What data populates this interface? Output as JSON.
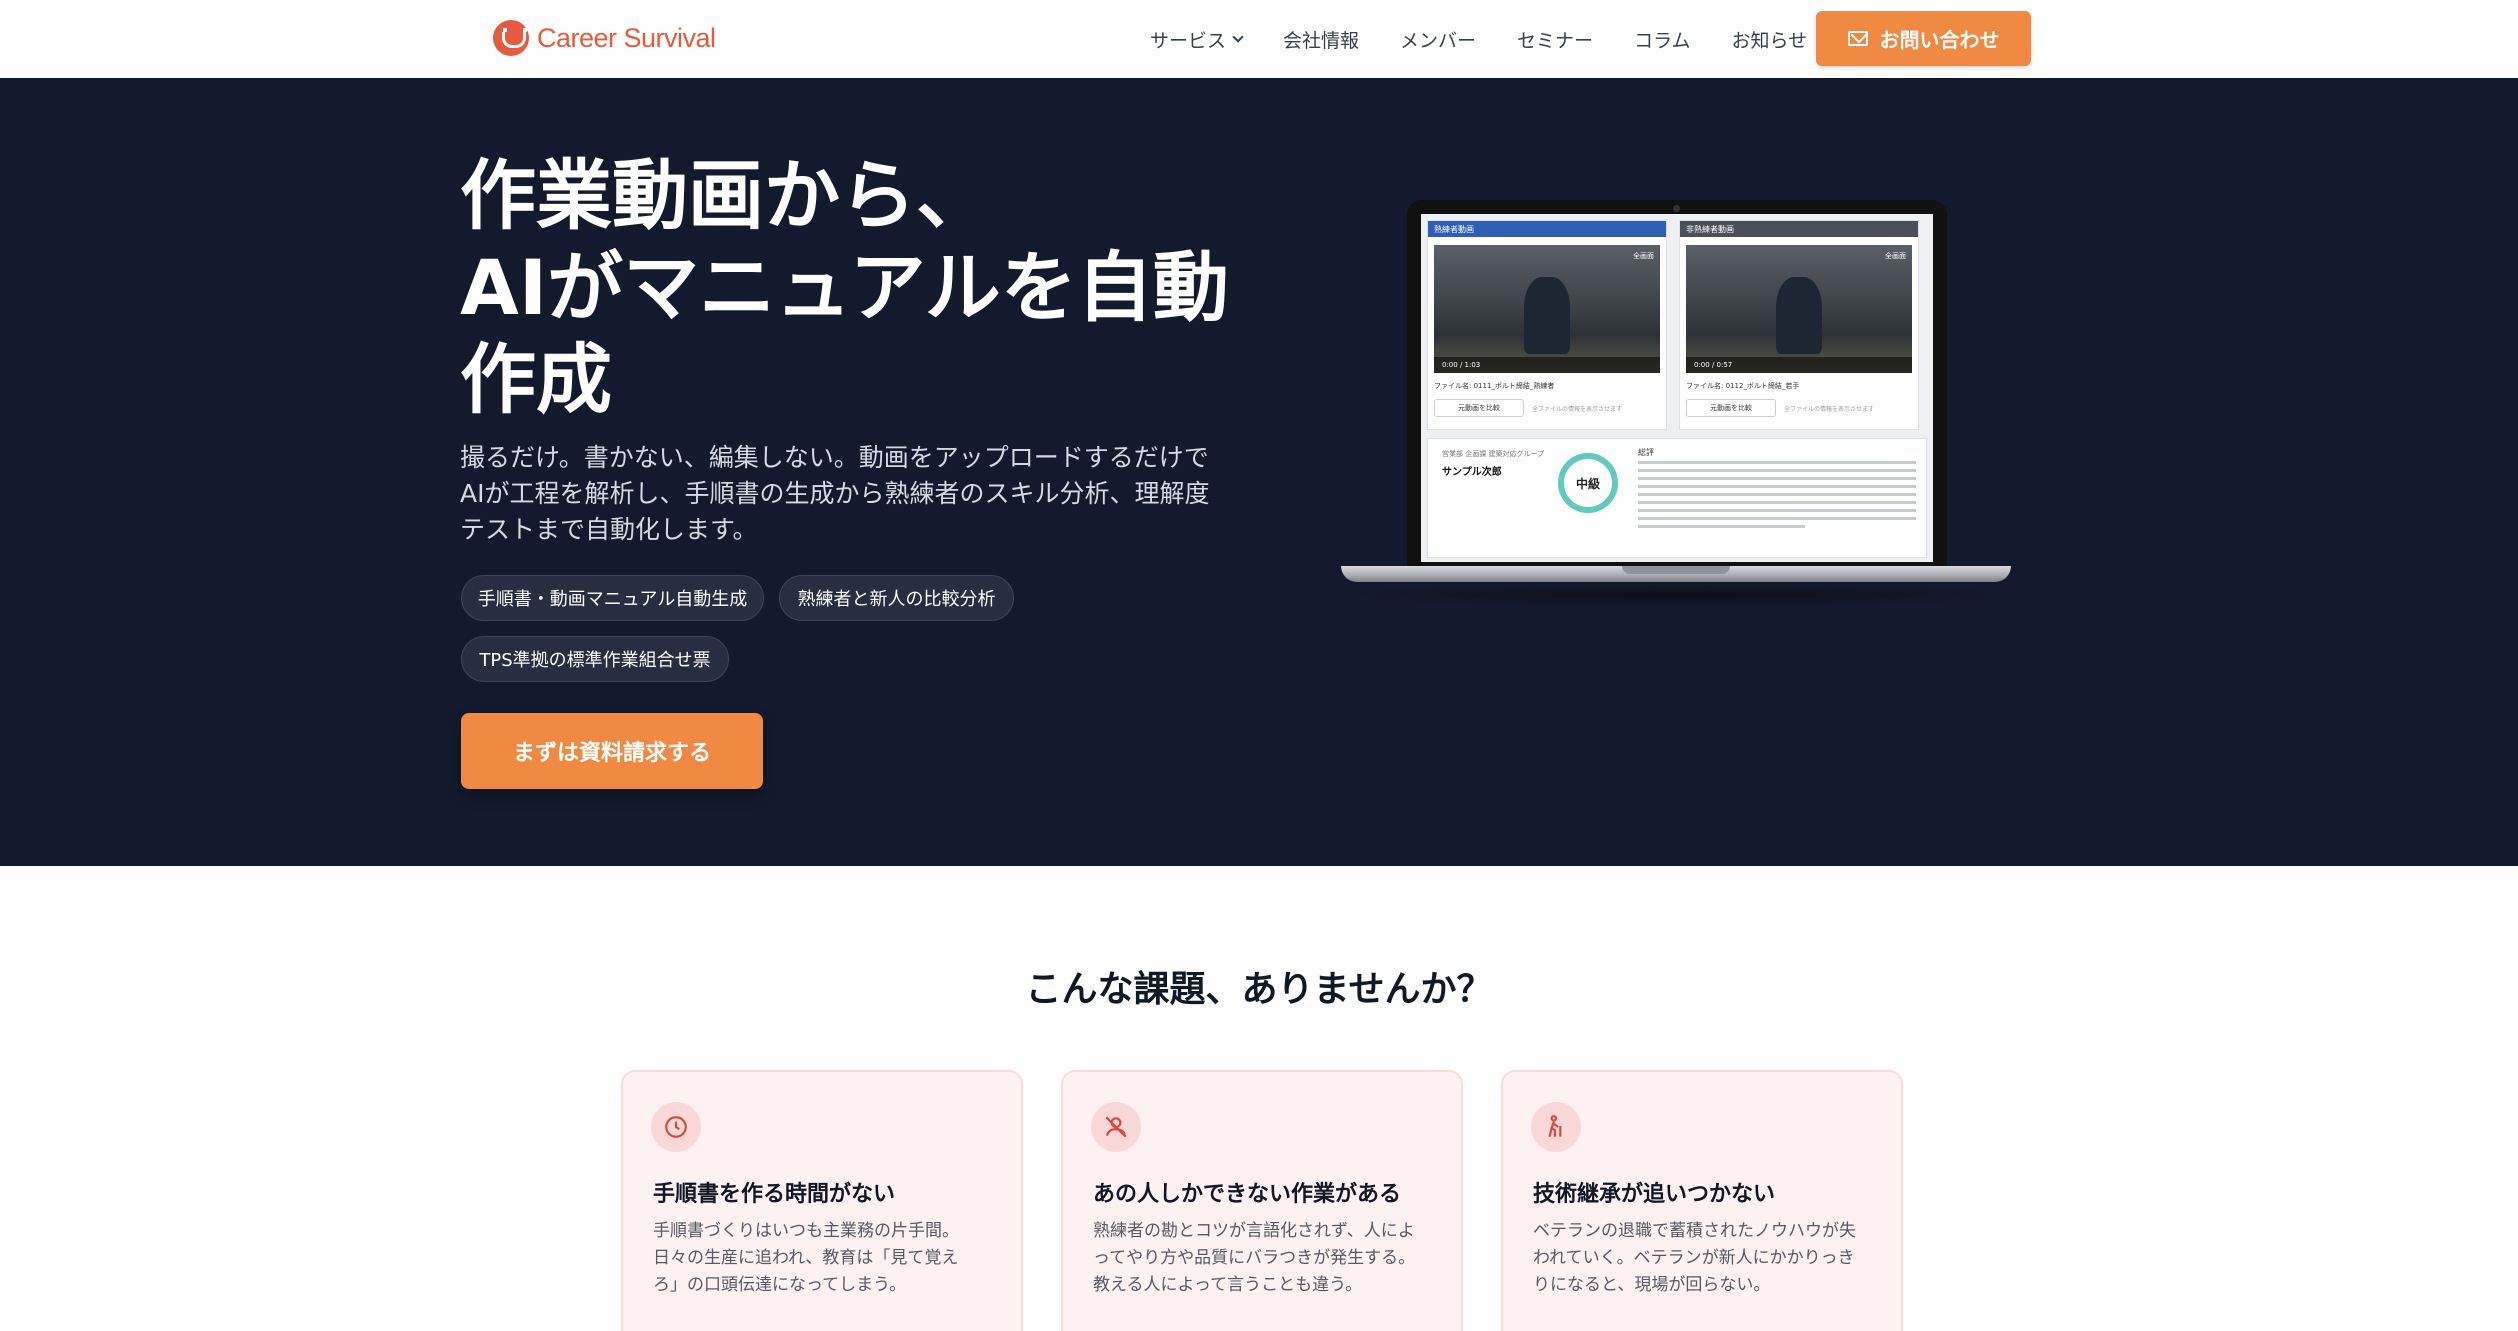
{
  "colors": {
    "accent": "#f08a42",
    "brand": "#e65a3f",
    "hero_bg": "#141a2e",
    "card_bg": "#fdf1f1",
    "icon_red": "#d9473f"
  },
  "nav": {
    "logo_text": "Career Survival",
    "items": [
      {
        "label": "サービス",
        "has_dropdown": true
      },
      {
        "label": "会社情報"
      },
      {
        "label": "メンバー"
      },
      {
        "label": "セミナー"
      },
      {
        "label": "コラム"
      },
      {
        "label": "お知らせ"
      }
    ],
    "contact_label": "お問い合わせ",
    "contact_icon": "mail-icon"
  },
  "hero": {
    "title_lines": [
      "作業動画から、",
      "AIがマニュアルを自動",
      "作成"
    ],
    "subtitle_lines": [
      "撮るだけ。書かない、編集しない。動画をアップロードするだけで",
      "AIが工程を解析し、手順書の生成から熟練者のスキル分析、理解度",
      "テストまで自動化します。"
    ],
    "chips": [
      "手順書・動画マニュアル自動生成",
      "熟練者と新人の比較分析",
      "TPS準拠の標準作業組合せ票"
    ],
    "cta_label": "まずは資料請求する"
  },
  "mockup": {
    "panels": [
      {
        "header": "熟練者動画",
        "header_color": "#2f5fb5",
        "fullscreen": "全画面",
        "time": "0:00 / 1:03",
        "file": "ファイル名: 0111_ボルト締結_熟練者",
        "button": "元動画を比較",
        "note": "全ファイルの情報を表示させます"
      },
      {
        "header": "非熟練者動画",
        "header_color": "#4a4f59",
        "fullscreen": "全画面",
        "time": "0:00 / 0:57",
        "file": "ファイル名: 0112_ボルト締結_若手",
        "button": "元動画を比較",
        "note": "全ファイルの情報を表示させます"
      }
    ],
    "result_group": "営業部 企画課 建築対応グループ",
    "result_name": "サンプル次郎",
    "level": "中級",
    "review_label": "総評"
  },
  "problems": {
    "title": "こんな課題、ありませんか？",
    "cards": [
      {
        "icon": "clock-icon",
        "title": "手順書を作る時間がない",
        "body_lines": [
          "手順書づくりはいつも主業務の片手間。",
          "日々の生産に追われ、教育は「見て覚え",
          "ろ」の口頭伝達になってしまう。"
        ]
      },
      {
        "icon": "person-off-icon",
        "title": "あの人しかできない作業がある",
        "body_lines": [
          "熟練者の勘とコツが言語化されず、人によ",
          "ってやり方や品質にバラつきが発生する。",
          "教える人によって言うことも違う。"
        ]
      },
      {
        "icon": "elderly-person-icon",
        "title": "技術継承が追いつかない",
        "body_lines": [
          "ベテランの退職で蓄積されたノウハウが失",
          "われていく。ベテランが新人にかかりっき",
          "りになると、現場が回らない。"
        ]
      }
    ]
  }
}
